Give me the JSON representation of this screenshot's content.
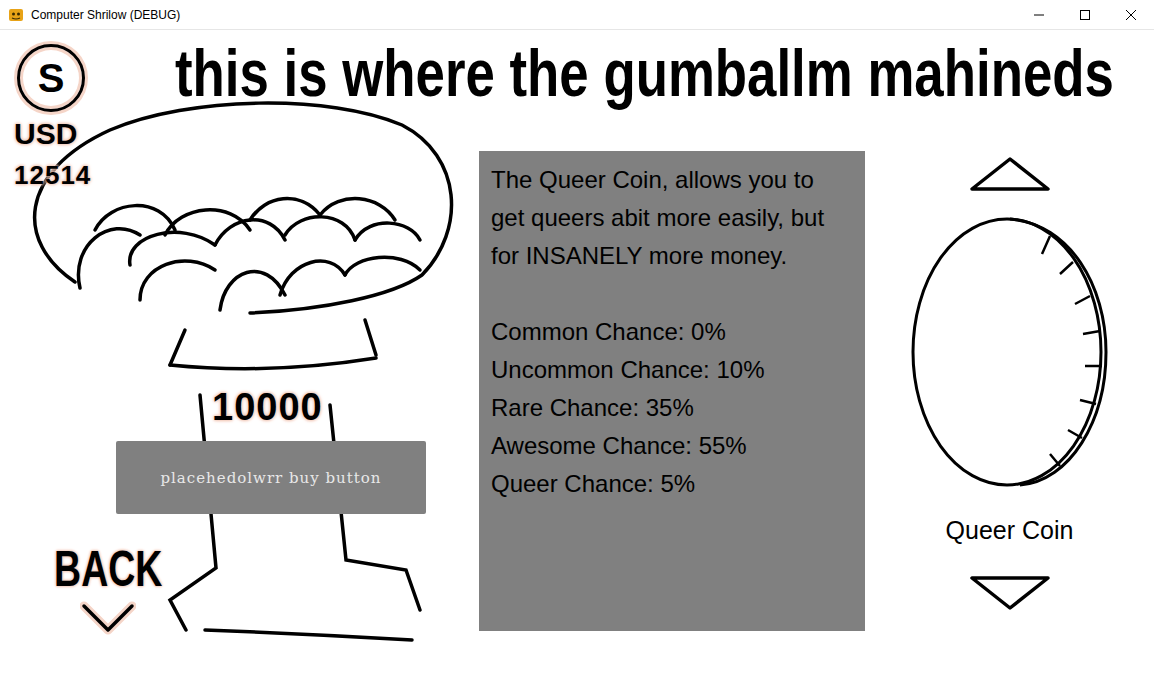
{
  "window": {
    "title": "Computer Shrilow (DEBUG)"
  },
  "wallet": {
    "symbol": "S",
    "currency": "USD",
    "balance": "12514"
  },
  "header": "this is where the gumballm mahineds",
  "machine": {
    "price": "10000",
    "buy_button": "placehedolwrr buy button"
  },
  "back_button": "BACK",
  "details": {
    "description": "The Queer Coin, allows you to get queers abit more easily, but for INSANELY more money.",
    "chances": [
      {
        "label": "Common Chance: 0%"
      },
      {
        "label": "Uncommon Chance: 10%"
      },
      {
        "label": "Rare Chance: 35%"
      },
      {
        "label": "Awesome Chance: 55%"
      },
      {
        "label": "Queer Chance: 5%"
      }
    ]
  },
  "coin_selector": {
    "name": "Queer Coin"
  }
}
